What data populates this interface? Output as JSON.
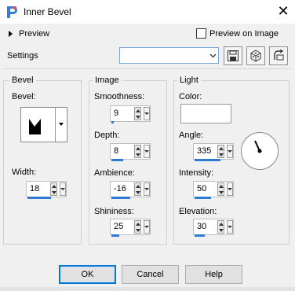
{
  "window": {
    "title": "Inner Bevel",
    "close_glyph": "✕",
    "app_icon": "paintshop-pro-icon"
  },
  "preview": {
    "label": "Preview",
    "preview_on_image_label": "Preview on Image",
    "preview_on_image_checked": false
  },
  "settings": {
    "label": "Settings",
    "value": "",
    "buttons": [
      "save-preset-icon",
      "randomize-cube-icon",
      "reset-icon"
    ]
  },
  "bevel": {
    "group_label": "Bevel",
    "bevel_label": "Bevel:",
    "width_label": "Width:",
    "width_value": "18"
  },
  "image": {
    "group_label": "Image",
    "smoothness_label": "Smoothness:",
    "smoothness_value": "9",
    "depth_label": "Depth:",
    "depth_value": "8",
    "ambience_label": "Ambience:",
    "ambience_value": "-16",
    "shininess_label": "Shininess:",
    "shininess_value": "25"
  },
  "light": {
    "group_label": "Light",
    "color_label": "Color:",
    "color_value": "#ffffff",
    "angle_label": "Angle:",
    "angle_value": "335",
    "intensity_label": "Intensity:",
    "intensity_value": "50",
    "elevation_label": "Elevation:",
    "elevation_value": "30"
  },
  "buttons": {
    "ok": "OK",
    "cancel": "Cancel",
    "help": "Help"
  },
  "colors": {
    "accent": "#0078d7",
    "slider_bar": "#2f7ad5"
  }
}
